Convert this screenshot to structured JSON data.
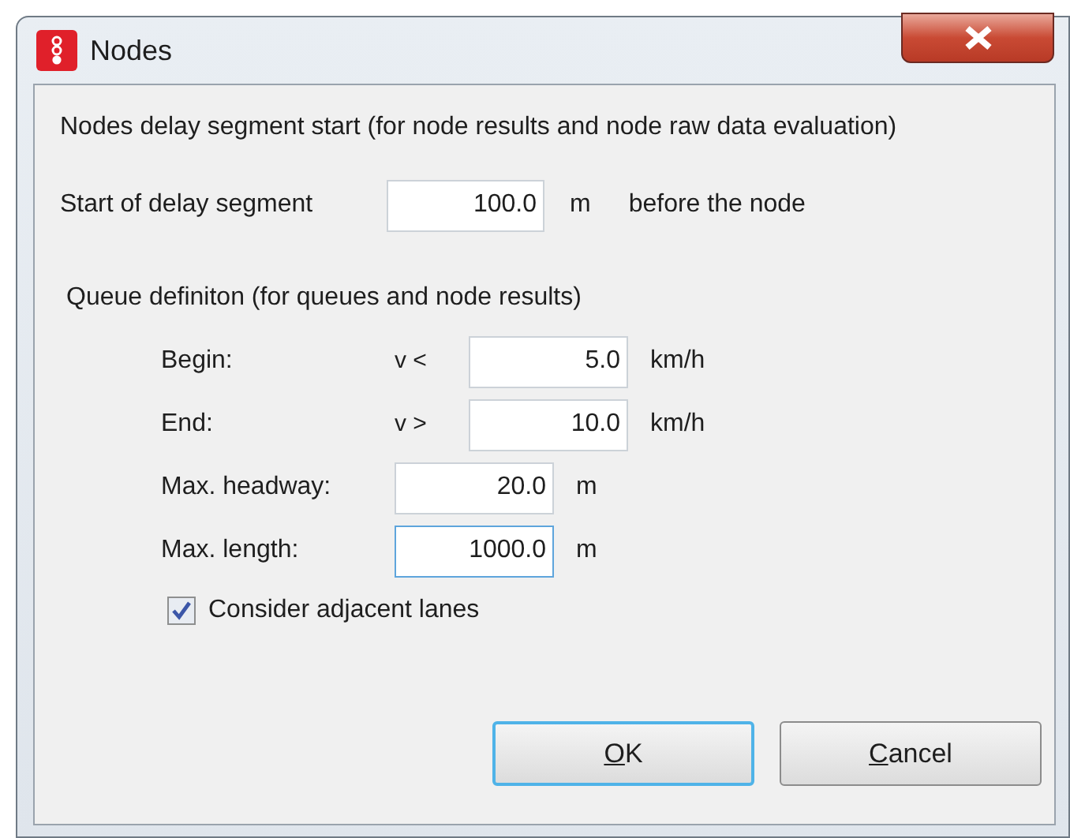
{
  "window": {
    "title": "Nodes"
  },
  "delay": {
    "heading": "Nodes delay segment start (for node results and node raw data evaluation)",
    "label": "Start of delay segment",
    "value": "100.0",
    "unit": "m",
    "suffix": "before the node"
  },
  "queue": {
    "heading": "Queue definiton (for queues and node results)",
    "rows": [
      {
        "label": "Begin:",
        "operator": "v <",
        "value": "5.0",
        "unit": "km/h",
        "focused": false
      },
      {
        "label": "End:",
        "operator": "v >",
        "value": "10.0",
        "unit": "km/h",
        "focused": false
      },
      {
        "label": "Max. headway:",
        "value": "20.0",
        "unit": "m",
        "focused": false
      },
      {
        "label": "Max. length:",
        "value": "1000.0",
        "unit": "m",
        "focused": true
      }
    ],
    "checkbox": {
      "label": "Consider adjacent lanes",
      "checked": true
    }
  },
  "buttons": [
    {
      "label": "OK",
      "default": true,
      "mnemonic_first": true
    },
    {
      "label": "Cancel",
      "default": false,
      "mnemonic_first": true
    }
  ]
}
